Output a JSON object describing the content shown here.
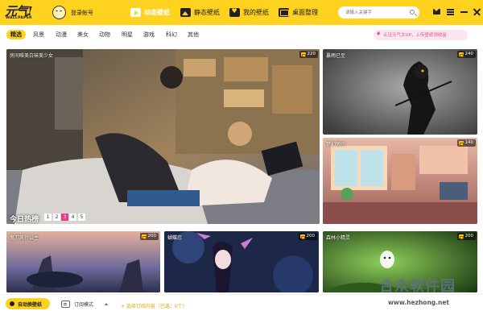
{
  "app": {
    "logo_text": "元气!",
    "logo_sub": "WALLPAPER",
    "login_label": "登录帐号"
  },
  "nav": {
    "items": [
      {
        "label": "动态壁纸",
        "icon": "play-icon",
        "active": true
      },
      {
        "label": "静态壁纸",
        "icon": "image-icon",
        "active": false
      },
      {
        "label": "我的壁纸",
        "icon": "heart-icon",
        "active": false
      },
      {
        "label": "桌面整理",
        "icon": "desktop-icon",
        "active": false
      }
    ]
  },
  "search": {
    "placeholder": "请输入关键字"
  },
  "window_controls": [
    "mail-icon",
    "menu-icon",
    "minimize-icon",
    "close-icon"
  ],
  "categories": [
    "精选",
    "风景",
    "动漫",
    "美女",
    "动物",
    "明星",
    "游戏",
    "科幻",
    "其他"
  ],
  "active_category": "精选",
  "promo": {
    "text": "认证元气太UP，上传壁纸领收益"
  },
  "cards": [
    {
      "title": "房间唯美白袜美少女",
      "count": "220"
    },
    {
      "title": "暴雨已至",
      "count": "240"
    },
    {
      "title": "梦幻房间",
      "count": "140"
    },
    {
      "title": "鬼刀风铃公主",
      "count": "200"
    },
    {
      "title": "蝴蝶忍",
      "count": "200"
    },
    {
      "title": "森林小精灵",
      "count": "200"
    }
  ],
  "hot": {
    "label": "今日热榜",
    "pages": [
      "1",
      "2",
      "3",
      "4",
      "5"
    ],
    "active_page": "3"
  },
  "bottom": {
    "auto_label": "自动换壁纸",
    "sub_mode_label": "订阅模式",
    "choose_sub_label": "+ 选择订阅内容（已选：0个）"
  },
  "watermark": {
    "text": "合众软件园",
    "url": "www.hezhong.net"
  },
  "colors": {
    "accent": "#ffd21f",
    "active_page": "#e93a8a",
    "promo_text": "#e0508a"
  }
}
